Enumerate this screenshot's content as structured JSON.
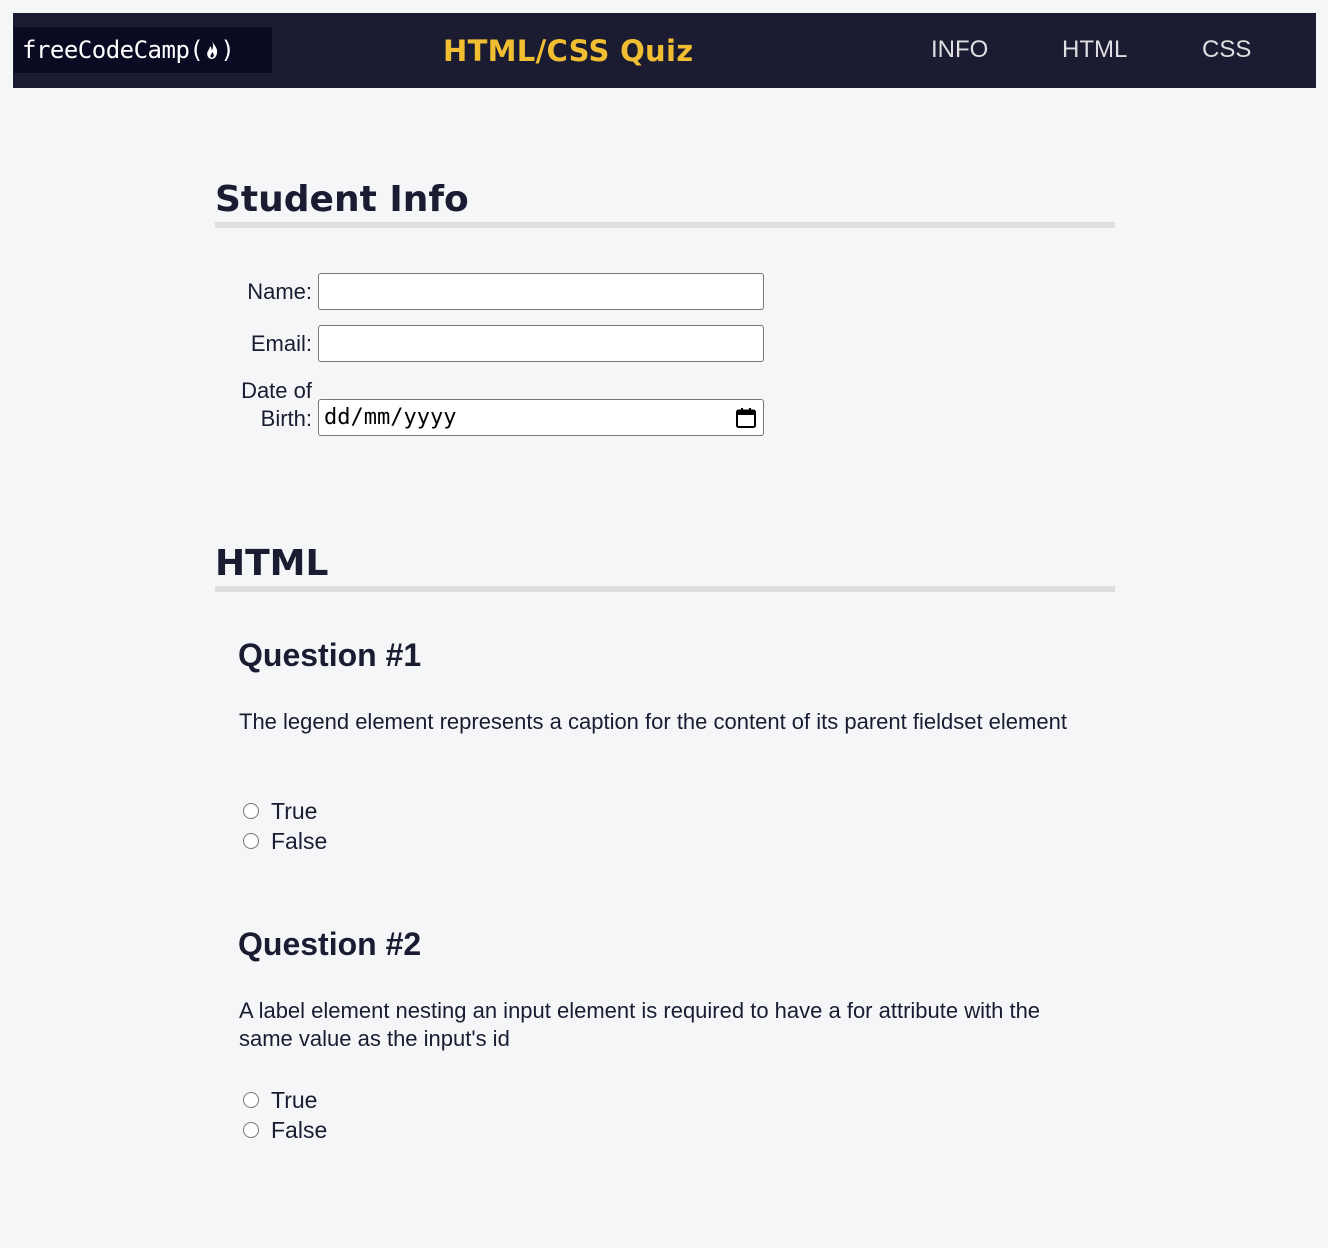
{
  "header": {
    "logo_text": "freeCodeCamp(",
    "logo_close": ")",
    "title": "HTML/CSS Quiz",
    "nav": [
      {
        "label": "INFO"
      },
      {
        "label": "HTML"
      },
      {
        "label": "CSS"
      }
    ]
  },
  "info_section": {
    "heading": "Student Info",
    "fields": {
      "name_label": "Name:",
      "name_value": "",
      "email_label": "Email:",
      "email_value": "",
      "dob_label_line1": "Date of",
      "dob_label_line2": "Birth:",
      "dob_placeholder": "dd/mm/yyyy"
    }
  },
  "html_section": {
    "heading": "HTML",
    "questions": [
      {
        "title": "Question #1",
        "text": "The legend element represents a caption for the content of its parent fieldset element",
        "options": [
          "True",
          "False"
        ]
      },
      {
        "title": "Question #2",
        "text": "A label element nesting an input element is required to have a for attribute with the same value as the input's id",
        "options": [
          "True",
          "False"
        ]
      }
    ]
  },
  "colors": {
    "nav_bg": "#1b1b32",
    "logo_bg": "#0a0a23",
    "title_accent": "#f1be32",
    "page_bg": "#f5f6f7",
    "divider": "#dfdfe2"
  }
}
